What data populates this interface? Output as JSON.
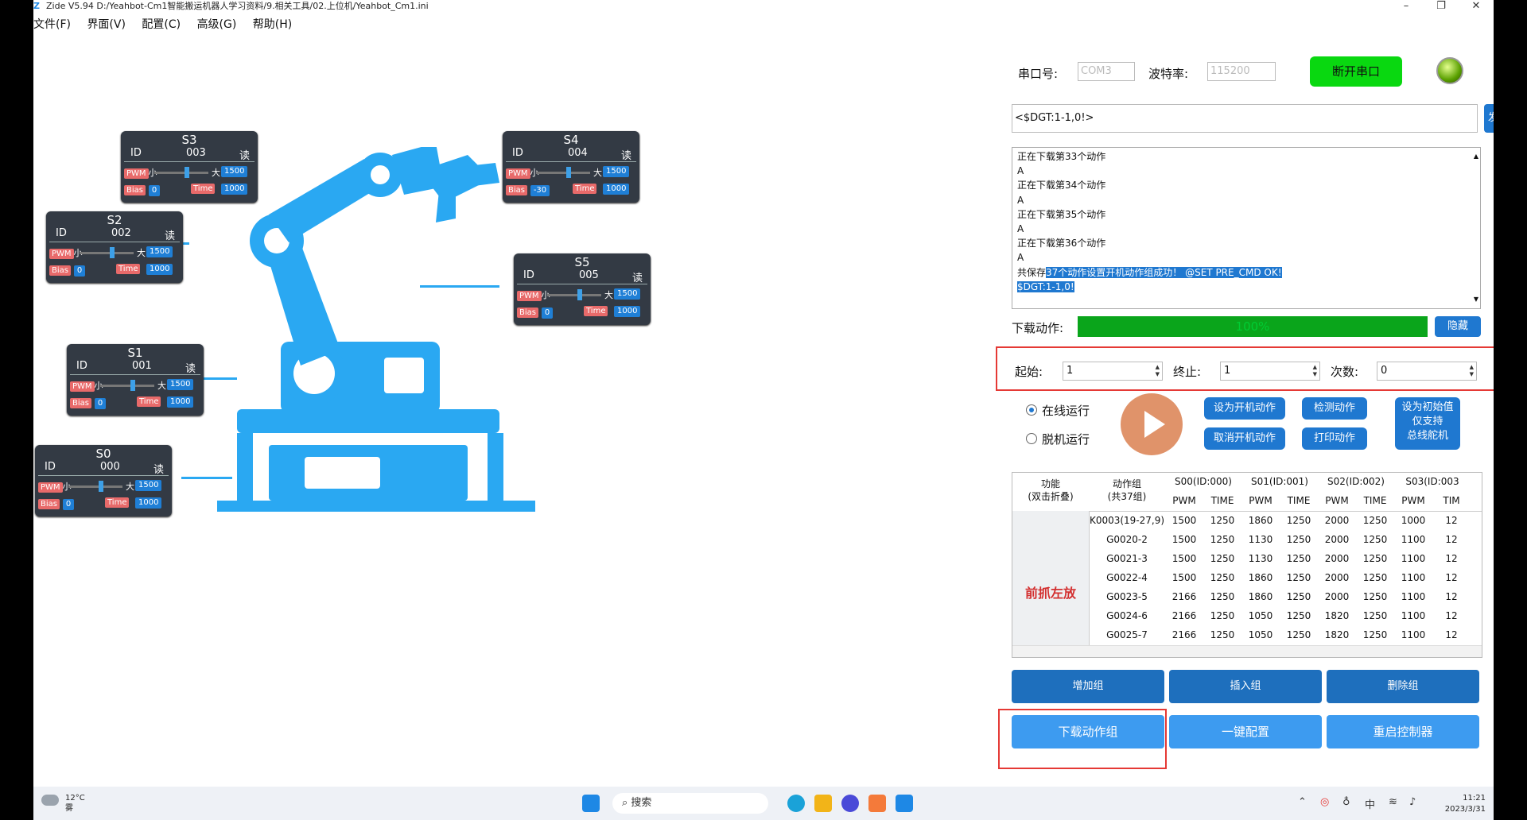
{
  "window": {
    "title": "Zide V5.94 D:/Yeahbot-Cm1智能搬运机器人学习资料/9.相关工具/02.上位机/Yeahbot_Cm1.ini"
  },
  "menu": [
    "文件(F)",
    "界面(V)",
    "配置(C)",
    "高级(G)",
    "帮助(H)"
  ],
  "servos": [
    {
      "name": "S3",
      "id_label": "ID",
      "id": "003",
      "read": "读",
      "pwm_tag": "PWM",
      "small": "小",
      "big": "大",
      "pwm": "1500",
      "bias_tag": "Bias",
      "bias": "0",
      "time_tag": "Time",
      "time": "1000"
    },
    {
      "name": "S4",
      "id_label": "ID",
      "id": "004",
      "read": "读",
      "pwm_tag": "PWM",
      "small": "小",
      "big": "大",
      "pwm": "1500",
      "bias_tag": "Bias",
      "bias": "-30",
      "time_tag": "Time",
      "time": "1000"
    },
    {
      "name": "S2",
      "id_label": "ID",
      "id": "002",
      "read": "读",
      "pwm_tag": "PWM",
      "small": "小",
      "big": "大",
      "pwm": "1500",
      "bias_tag": "Bias",
      "bias": "0",
      "time_tag": "Time",
      "time": "1000"
    },
    {
      "name": "S5",
      "id_label": "ID",
      "id": "005",
      "read": "读",
      "pwm_tag": "PWM",
      "small": "小",
      "big": "大",
      "pwm": "1500",
      "bias_tag": "Bias",
      "bias": "0",
      "time_tag": "Time",
      "time": "1000"
    },
    {
      "name": "S1",
      "id_label": "ID",
      "id": "001",
      "read": "读",
      "pwm_tag": "PWM",
      "small": "小",
      "big": "大",
      "pwm": "1500",
      "bias_tag": "Bias",
      "bias": "0",
      "time_tag": "Time",
      "time": "1000"
    },
    {
      "name": "S0",
      "id_label": "ID",
      "id": "000",
      "read": "读",
      "pwm_tag": "PWM",
      "small": "小",
      "big": "大",
      "pwm": "1500",
      "bias_tag": "Bias",
      "bias": "0",
      "time_tag": "Time",
      "time": "1000"
    }
  ],
  "serial": {
    "port_label": "串口号:",
    "port_value": "COM3",
    "baud_label": "波特率:",
    "baud_value": "115200",
    "disconnect_label": "断开串口"
  },
  "command": {
    "value": "<$DGT:1-1,0!>",
    "send_label": "发送"
  },
  "log": {
    "lines": [
      "正在下载第33个动作",
      "A",
      "正在下载第34个动作",
      "A",
      "正在下载第35个动作",
      "A",
      "正在下载第36个动作",
      "A"
    ],
    "last_prefix": "共保存",
    "last_highlight": "37个动作设置开机动作组成功！ @SET PRE_CMD OK!",
    "final_highlight": "$DGT:1-1,0!"
  },
  "download": {
    "label": "下载动作:",
    "progress_text": "100%",
    "progress": 100,
    "hide_label": "隐藏"
  },
  "range": {
    "start_label": "起始:",
    "start_value": "1",
    "end_label": "终止:",
    "end_value": "1",
    "count_label": "次数:",
    "count_value": "0"
  },
  "run": {
    "online_label": "在线运行",
    "offline_label": "脱机运行"
  },
  "actions": {
    "set_boot": "设为开机动作",
    "cancel_boot": "取消开机动作",
    "detect": "检测动作",
    "print": "打印动作",
    "init_line1": "设为初始值",
    "init_line2": "仅支持",
    "init_line3": "总线舵机"
  },
  "table": {
    "func_header": "功能\n(双击折叠)",
    "group_header": "动作组\n(共37组)",
    "servo_headers": [
      "S00(ID:000)",
      "S01(ID:001)",
      "S02(ID:002)",
      "S03(ID:003"
    ],
    "sub_headers": [
      "PWM",
      "TIME",
      "PWM",
      "TIME",
      "PWM",
      "TIME",
      "PWM",
      "TIM"
    ],
    "func_name": "前抓左放",
    "rows": [
      {
        "group": "K0003(19-27,9)",
        "vals": [
          "1500",
          "1250",
          "1860",
          "1250",
          "2000",
          "1250",
          "1000",
          "12"
        ]
      },
      {
        "group": "G0020-2",
        "vals": [
          "1500",
          "1250",
          "1130",
          "1250",
          "2000",
          "1250",
          "1100",
          "12"
        ]
      },
      {
        "group": "G0021-3",
        "vals": [
          "1500",
          "1250",
          "1130",
          "1250",
          "2000",
          "1250",
          "1100",
          "12"
        ]
      },
      {
        "group": "G0022-4",
        "vals": [
          "1500",
          "1250",
          "1860",
          "1250",
          "2000",
          "1250",
          "1100",
          "12"
        ]
      },
      {
        "group": "G0023-5",
        "vals": [
          "2166",
          "1250",
          "1860",
          "1250",
          "2000",
          "1250",
          "1100",
          "12"
        ]
      },
      {
        "group": "G0024-6",
        "vals": [
          "2166",
          "1250",
          "1050",
          "1250",
          "1820",
          "1250",
          "1100",
          "12"
        ]
      },
      {
        "group": "G0025-7",
        "vals": [
          "2166",
          "1250",
          "1050",
          "1250",
          "1820",
          "1250",
          "1100",
          "12"
        ]
      }
    ]
  },
  "bottom_buttons": {
    "add": "增加组",
    "insert": "插入组",
    "delete": "删除组",
    "download_group": "下载动作组",
    "one_key": "一键配置",
    "restart": "重启控制器"
  },
  "taskbar": {
    "temp": "12°C",
    "weather": "雾",
    "search": "搜索",
    "ime": "中",
    "time": "11:21",
    "date": "2023/3/31"
  }
}
